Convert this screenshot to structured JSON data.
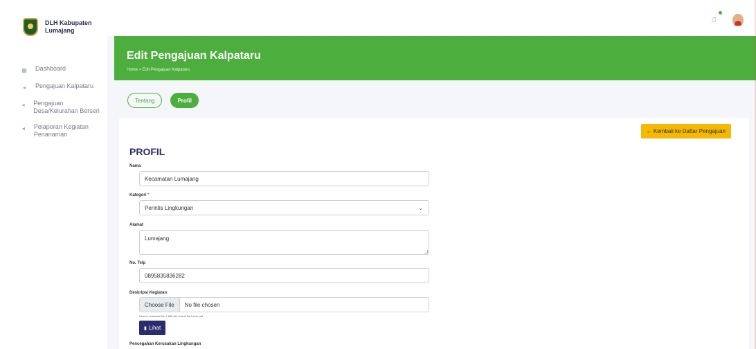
{
  "brand": {
    "line1": "DLH Kabupaten",
    "line2": "Lumajang"
  },
  "sidebar": {
    "items": [
      {
        "icon": "dashboard-icon",
        "label": "Dashboard"
      },
      {
        "icon": "send-icon",
        "label": "Pengajuan Kalpataru"
      },
      {
        "icon": "send-icon",
        "label": "Pengajuan Desa/Kelurahan Berseri"
      },
      {
        "icon": "send-icon",
        "label": "Pelaporan Kegiatan Penanaman"
      }
    ]
  },
  "header": {
    "title": "Edit Pengajuan Kalpataru",
    "breadcrumb": "Home > Edit Pengajuan Kalpataru"
  },
  "tabs": {
    "tentang": "Tentang",
    "profil": "Profil"
  },
  "form": {
    "back_label": "← Kembali ke Daftar Pengajuan",
    "section_title": "PROFIL",
    "nama_label": "Nama",
    "nama_value": "Kecamatan Lumajang",
    "kategori_label": "Kategori",
    "kategori_req": "*",
    "kategori_value": "Perintis Lingkungan",
    "alamat_label": "Alamat",
    "alamat_value": "Lumajang",
    "telp_label": "No. Telp",
    "telp_value": "0895835836282",
    "deskripsi_label": "Deskripsi Kegiatan",
    "file_button": "Choose File",
    "file_status": "No file chosen",
    "file_hint": "Ukuran maksimal file 2 MB dan format file harus pdf",
    "view_label": "Lihat",
    "next_label": "Pencegahan Kerusakan Lingkungan"
  },
  "colors": {
    "primary_green": "#4cae3c",
    "accent_yellow": "#f6b800",
    "navy": "#2b2b6e"
  }
}
